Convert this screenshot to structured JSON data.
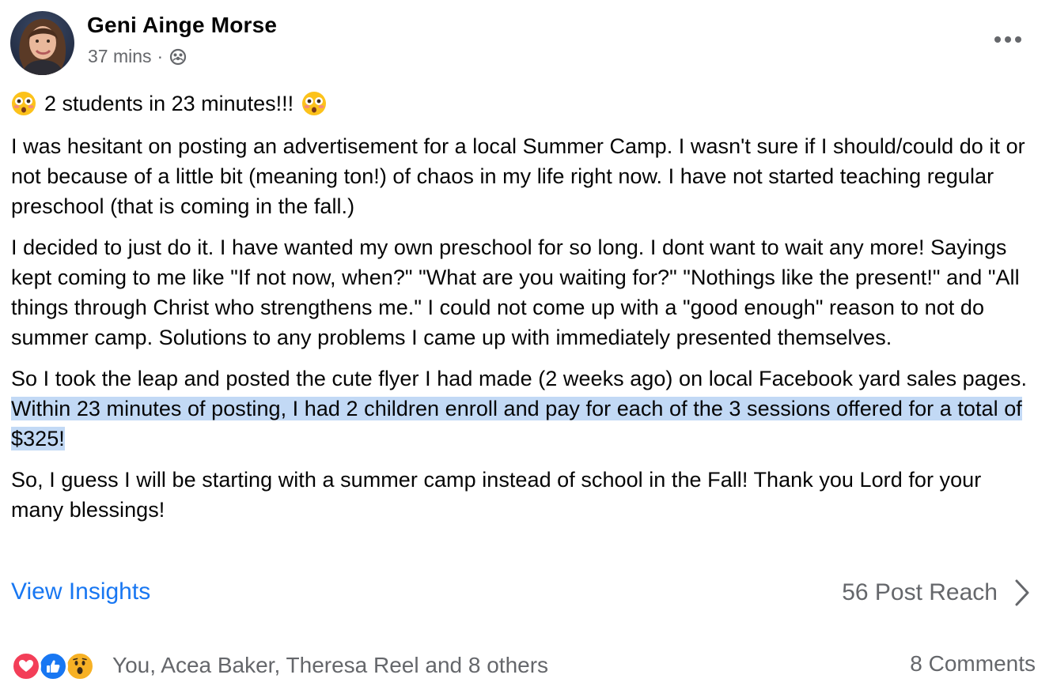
{
  "post": {
    "author": "Geni Ainge Morse",
    "time": "37 mins",
    "separator": "·",
    "privacy_icon": "friends-icon",
    "more_icon": "more-horizontal-icon",
    "headline": "2 students in 23 minutes!!!",
    "headline_emoji": "flushed-face-emoji",
    "paragraphs": [
      "I was hesitant on posting an advertisement for a local Summer Camp. I wasn't sure if I should/could do it or not because of a little bit (meaning ton!) of chaos in my life right now. I have not started teaching regular preschool (that is coming in the fall.)",
      "I decided to just do it. I have wanted my own preschool for so long. I dont want to wait any more! Sayings kept coming to me like \"If not now, when?\" \"What are you waiting for?\" \"Nothings like the present!\" and \"All things through Christ who strengthens me.\" I could not come up with a \"good enough\" reason to not do summer camp. Solutions to any problems I came up with immediately presented themselves."
    ],
    "paragraph3_plain": "So I took the leap and posted the cute flyer I had made (2 weeks ago) on local Facebook yard sales pages. ",
    "paragraph3_highlighted": "Within 23 minutes of posting, I had 2 children enroll and pay for each of the 3 sessions offered for a total of $325!",
    "paragraph4": "So, I guess I will be starting with a summer camp instead of school in the Fall! Thank you Lord for your many blessings!"
  },
  "footer": {
    "insights_label": "View Insights",
    "reach_label": "56 Post Reach",
    "reach_icon": "chevron-right-icon",
    "reaction_icons": [
      "love-reaction-icon",
      "like-reaction-icon",
      "wow-reaction-icon"
    ],
    "reactors_label": "You, Acea Baker, Theresa Reel and 8 others",
    "comments_label": "8 Comments"
  },
  "colors": {
    "link": "#1877f2",
    "secondary_text": "#65676b",
    "highlight": "#c2d9f5",
    "love": "#f33e58",
    "like": "#1877f2",
    "wow": "#f7b125"
  }
}
